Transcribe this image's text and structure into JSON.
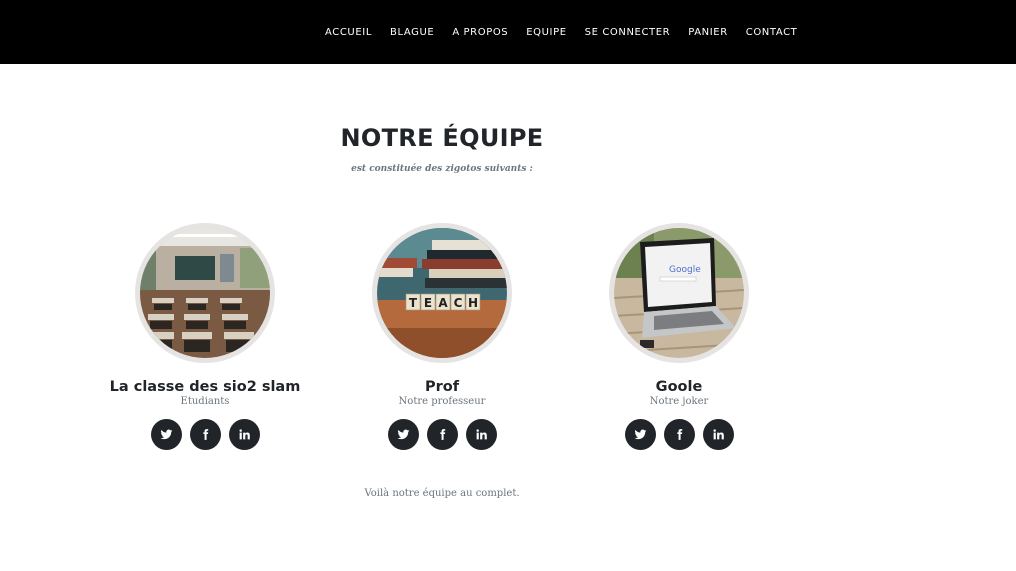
{
  "nav": {
    "items": [
      "ACCUEIL",
      "BLAGUE",
      "A PROPOS",
      "EQUIPE",
      "SE CONNECTER",
      "PANIER",
      "CONTACT"
    ]
  },
  "team": {
    "heading": "NOTRE ÉQUIPE",
    "subheading": "est constituée des zigotos suivants :",
    "members": [
      {
        "name": "La classe des sio2 slam",
        "role": "Etudiants",
        "photo": "classroom-photo"
      },
      {
        "name": "Prof",
        "role": "Notre professeur",
        "photo": "teach-blocks-photo"
      },
      {
        "name": "Goole",
        "role": "Notre joker",
        "photo": "laptop-google-photo"
      }
    ],
    "social_icons": [
      "twitter-icon",
      "facebook-icon",
      "linkedin-icon"
    ],
    "footer": "Voilà notre équipe au complet."
  },
  "colors": {
    "navbar": "#000000",
    "heading": "#212529",
    "muted": "#6c757d",
    "social_bg": "#212529",
    "photo_border": "#e6e3e3"
  }
}
